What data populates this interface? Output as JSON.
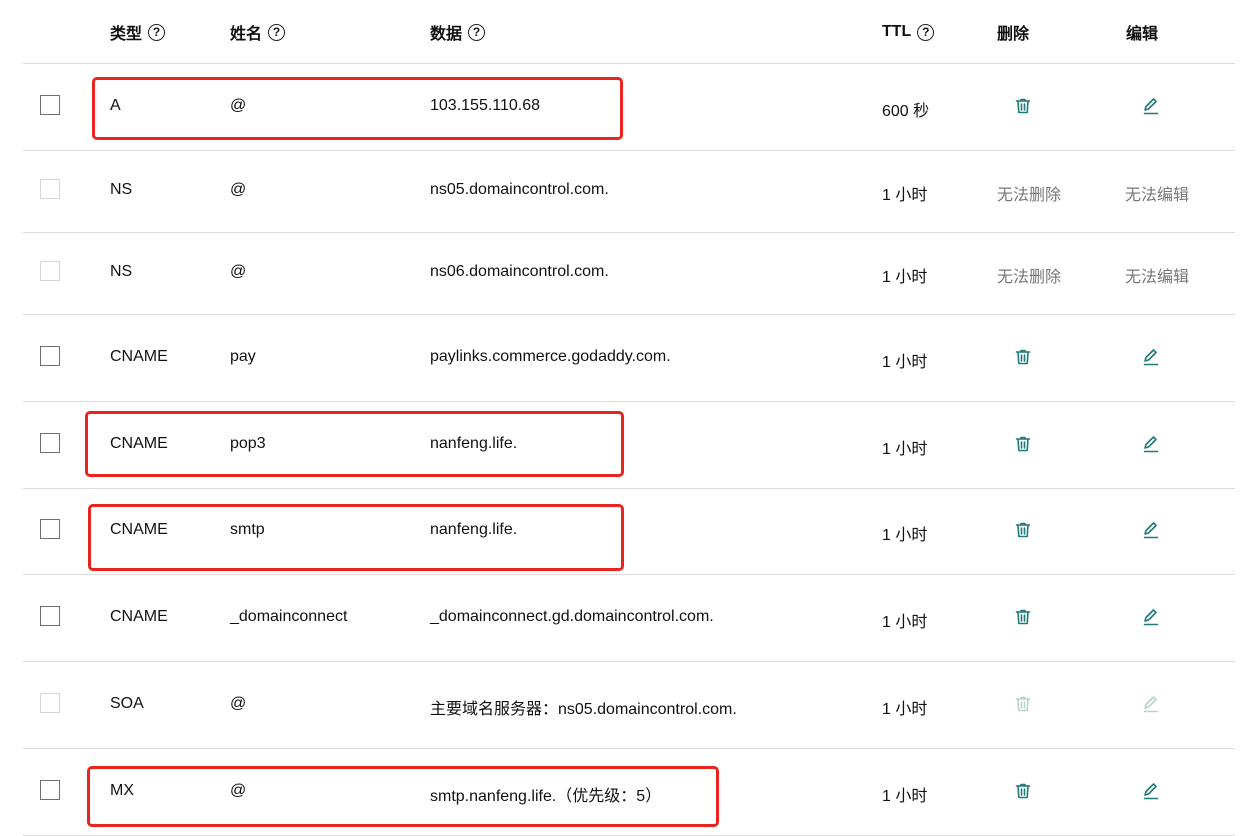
{
  "header": {
    "type": "类型",
    "name": "姓名",
    "data": "数据",
    "ttl": "TTL",
    "delete": "删除",
    "edit": "编辑",
    "help_glyph": "?"
  },
  "records": [
    {
      "type": "A",
      "name": "@",
      "data": "103.155.110.68",
      "ttl": "600 秒",
      "deletable": true,
      "editable": true
    },
    {
      "type": "NS",
      "name": "@",
      "data": "ns05.domaincontrol.com.",
      "ttl": "1 小时",
      "deletable": false,
      "editable": false,
      "delete_text": "无法删除",
      "edit_text": "无法编辑"
    },
    {
      "type": "NS",
      "name": "@",
      "data": "ns06.domaincontrol.com.",
      "ttl": "1 小时",
      "deletable": false,
      "editable": false,
      "delete_text": "无法删除",
      "edit_text": "无法编辑"
    },
    {
      "type": "CNAME",
      "name": "pay",
      "data": "paylinks.commerce.godaddy.com.",
      "ttl": "1 小时",
      "deletable": true,
      "editable": true
    },
    {
      "type": "CNAME",
      "name": "pop3",
      "data": "nanfeng.life.",
      "ttl": "1 小时",
      "deletable": true,
      "editable": true
    },
    {
      "type": "CNAME",
      "name": "smtp",
      "data": "nanfeng.life.",
      "ttl": "1 小时",
      "deletable": true,
      "editable": true
    },
    {
      "type": "CNAME",
      "name": "_domainconnect",
      "data": "_domainconnect.gd.domaincontrol.com.",
      "ttl": "1 小时",
      "deletable": true,
      "editable": true
    },
    {
      "type": "SOA",
      "name": "@",
      "data": "主要域名服务器：ns05.domaincontrol.com.",
      "ttl": "1 小时",
      "deletable": "disabled-icon",
      "editable": "disabled-icon"
    },
    {
      "type": "MX",
      "name": "@",
      "data": "smtp.nanfeng.life.（优先级：5）",
      "ttl": "1 小时",
      "deletable": true,
      "editable": true
    }
  ],
  "colors": {
    "icon_active": "#1f7a78",
    "icon_disabled": "#b8d3d2",
    "highlight": "#e8241f",
    "separator": "#dcdcdc"
  }
}
